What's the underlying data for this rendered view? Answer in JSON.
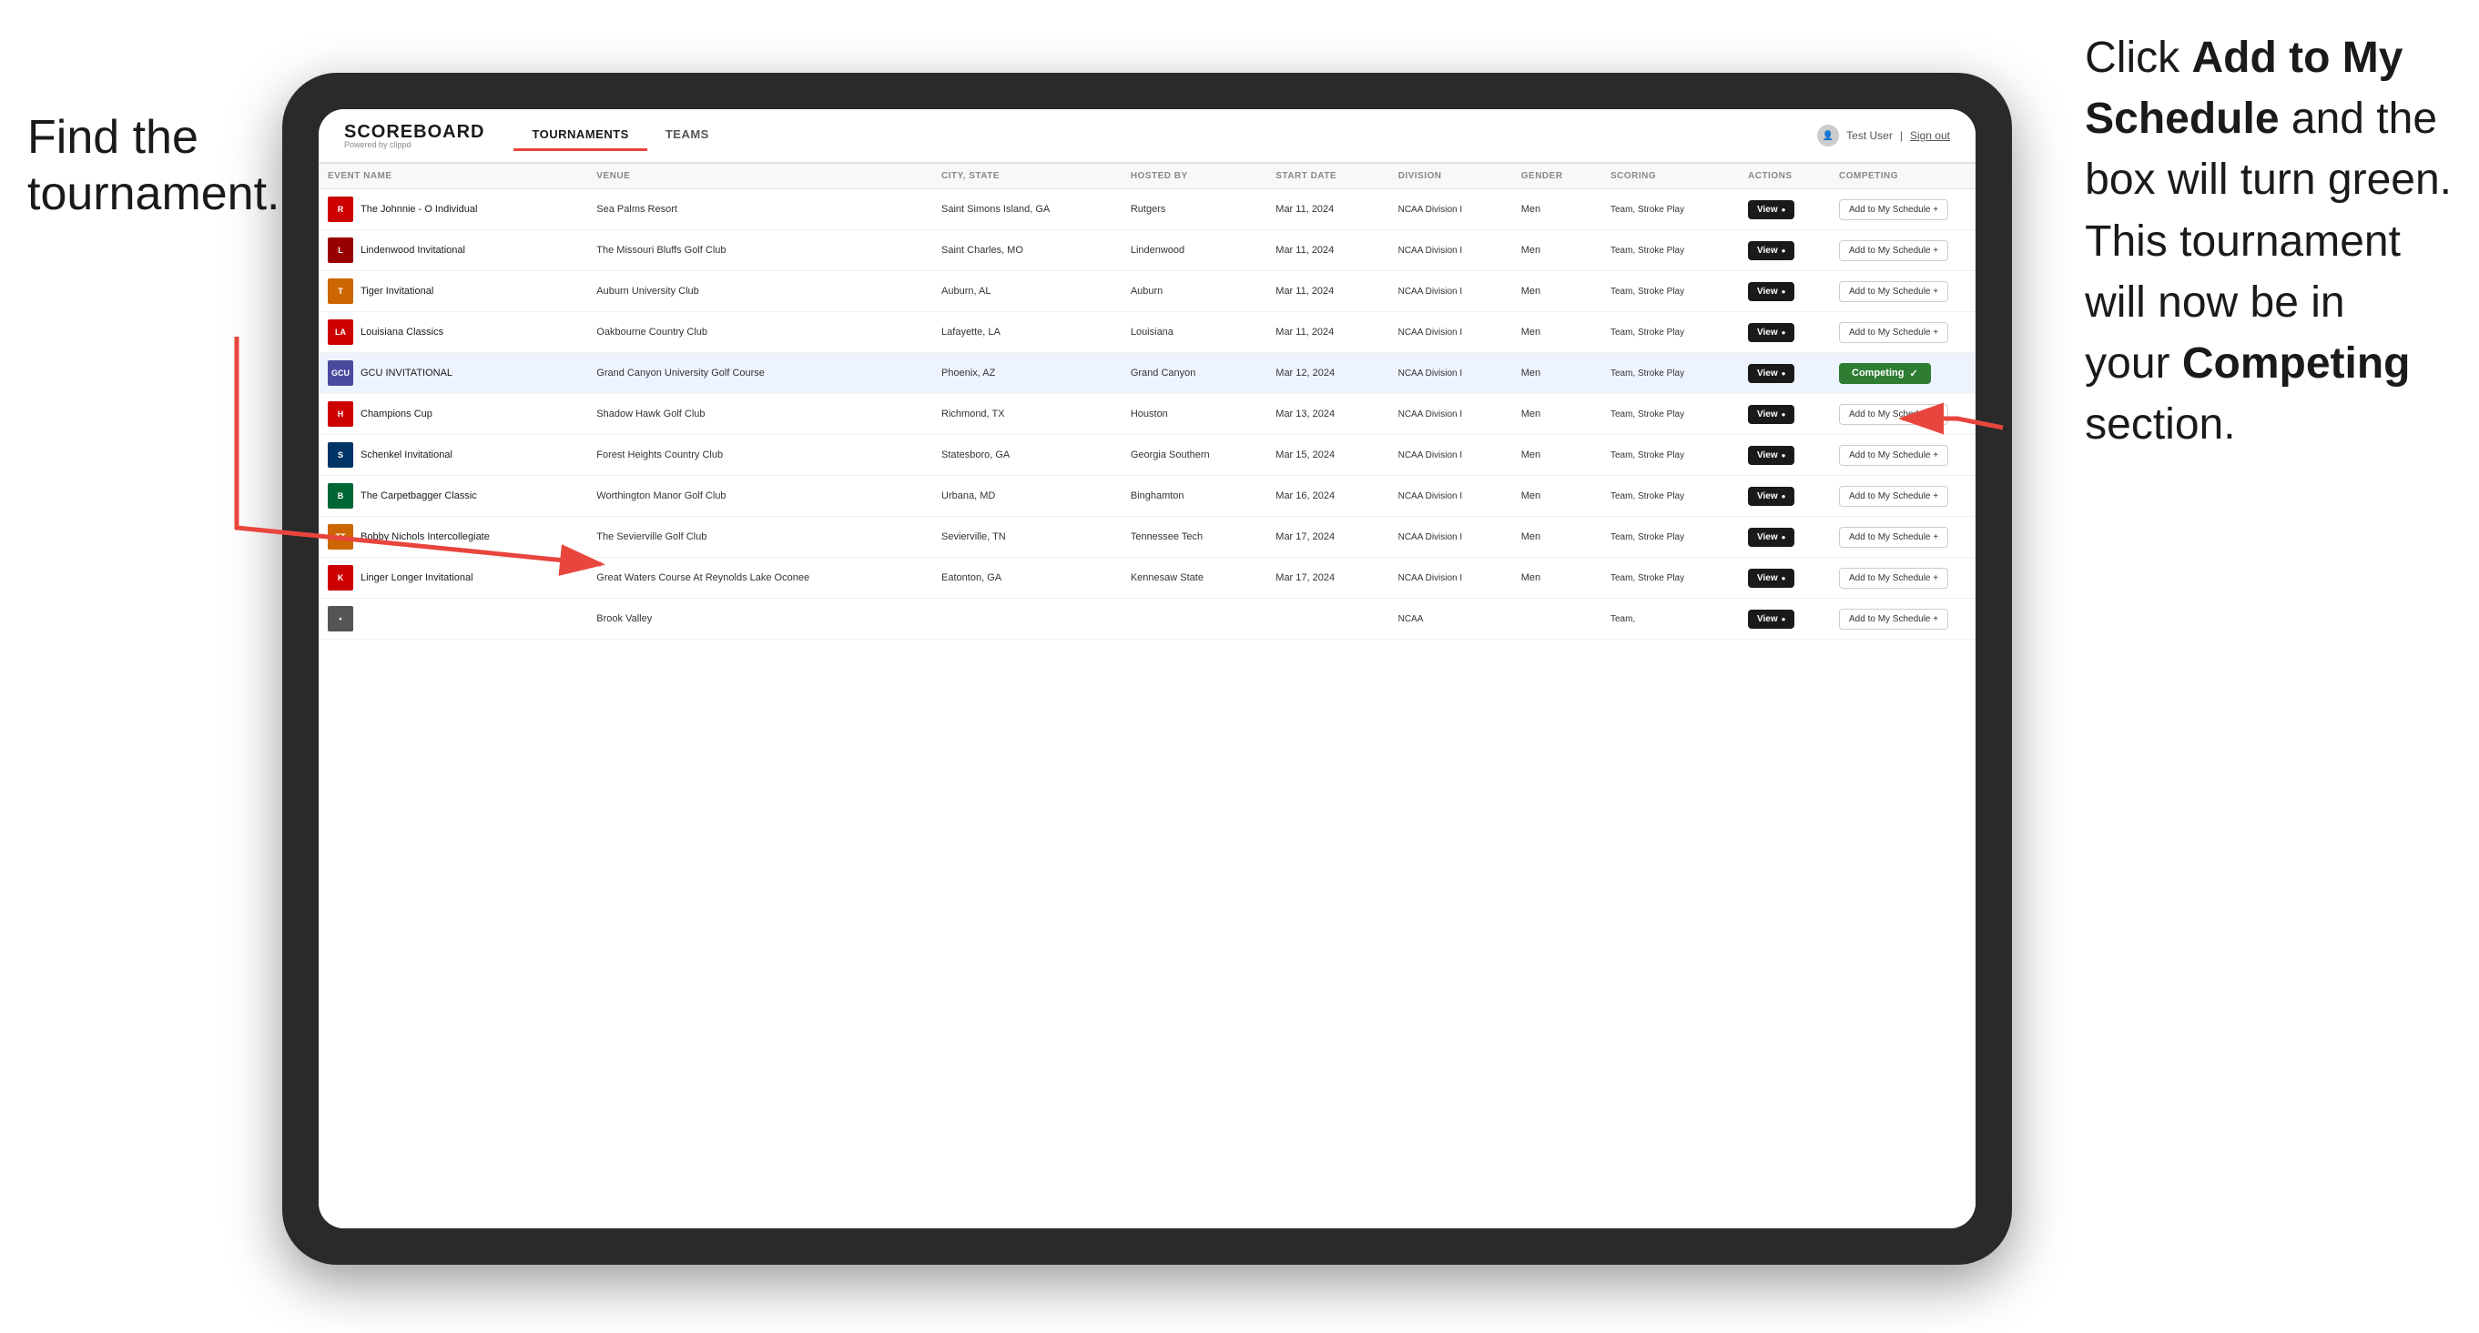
{
  "annotations": {
    "left": "Find the\ntournament.",
    "right_line1": "Click ",
    "right_bold1": "Add to My\nSchedule",
    "right_line2": " and the\nbox will turn green.\nThis tournament\nwill now be in\nyour ",
    "right_bold2": "Competing",
    "right_line3": "\nsection."
  },
  "app": {
    "logo_main": "SCOREBOARD",
    "logo_sub": "Powered by clippd",
    "nav_tabs": [
      "TOURNAMENTS",
      "TEAMS"
    ],
    "active_tab": "TOURNAMENTS",
    "user_label": "Test User",
    "signout_label": "Sign out"
  },
  "table": {
    "headers": [
      "EVENT NAME",
      "VENUE",
      "CITY, STATE",
      "HOSTED BY",
      "START DATE",
      "DIVISION",
      "GENDER",
      "SCORING",
      "ACTIONS",
      "COMPETING"
    ],
    "rows": [
      {
        "id": 1,
        "logo_color": "#cc0000",
        "logo_text": "R",
        "event_name": "The Johnnie - O Individual",
        "venue": "Sea Palms Resort",
        "city_state": "Saint Simons Island, GA",
        "hosted_by": "Rutgers",
        "start_date": "Mar 11, 2024",
        "division": "NCAA Division I",
        "gender": "Men",
        "scoring": "Team, Stroke Play",
        "action": "View",
        "competing_status": "add",
        "competing_label": "Add to My Schedule +",
        "highlighted": false
      },
      {
        "id": 2,
        "logo_color": "#990000",
        "logo_text": "L",
        "event_name": "Lindenwood Invitational",
        "venue": "The Missouri Bluffs Golf Club",
        "city_state": "Saint Charles, MO",
        "hosted_by": "Lindenwood",
        "start_date": "Mar 11, 2024",
        "division": "NCAA Division I",
        "gender": "Men",
        "scoring": "Team, Stroke Play",
        "action": "View",
        "competing_status": "add",
        "competing_label": "Add to My Schedule +",
        "highlighted": false
      },
      {
        "id": 3,
        "logo_color": "#cc6600",
        "logo_text": "T",
        "event_name": "Tiger Invitational",
        "venue": "Auburn University Club",
        "city_state": "Auburn, AL",
        "hosted_by": "Auburn",
        "start_date": "Mar 11, 2024",
        "division": "NCAA Division I",
        "gender": "Men",
        "scoring": "Team, Stroke Play",
        "action": "View",
        "competing_status": "add",
        "competing_label": "Add to My Schedule +",
        "highlighted": false
      },
      {
        "id": 4,
        "logo_color": "#cc0000",
        "logo_text": "LA",
        "event_name": "Louisiana Classics",
        "venue": "Oakbourne Country Club",
        "city_state": "Lafayette, LA",
        "hosted_by": "Louisiana",
        "start_date": "Mar 11, 2024",
        "division": "NCAA Division I",
        "gender": "Men",
        "scoring": "Team, Stroke Play",
        "action": "View",
        "competing_status": "add",
        "competing_label": "Add to My Schedule +",
        "highlighted": false
      },
      {
        "id": 5,
        "logo_color": "#4a4a9e",
        "logo_text": "GCU",
        "event_name": "GCU INVITATIONAL",
        "venue": "Grand Canyon University Golf Course",
        "city_state": "Phoenix, AZ",
        "hosted_by": "Grand Canyon",
        "start_date": "Mar 12, 2024",
        "division": "NCAA Division I",
        "gender": "Men",
        "scoring": "Team, Stroke Play",
        "action": "View",
        "competing_status": "competing",
        "competing_label": "Competing ✓",
        "highlighted": true
      },
      {
        "id": 6,
        "logo_color": "#cc0000",
        "logo_text": "H",
        "event_name": "Champions Cup",
        "venue": "Shadow Hawk Golf Club",
        "city_state": "Richmond, TX",
        "hosted_by": "Houston",
        "start_date": "Mar 13, 2024",
        "division": "NCAA Division I",
        "gender": "Men",
        "scoring": "Team, Stroke Play",
        "action": "View",
        "competing_status": "add",
        "competing_label": "Add to My Schedule +",
        "highlighted": false
      },
      {
        "id": 7,
        "logo_color": "#003366",
        "logo_text": "S",
        "event_name": "Schenkel Invitational",
        "venue": "Forest Heights Country Club",
        "city_state": "Statesboro, GA",
        "hosted_by": "Georgia Southern",
        "start_date": "Mar 15, 2024",
        "division": "NCAA Division I",
        "gender": "Men",
        "scoring": "Team, Stroke Play",
        "action": "View",
        "competing_status": "add",
        "competing_label": "Add to My Schedule +",
        "highlighted": false
      },
      {
        "id": 8,
        "logo_color": "#006633",
        "logo_text": "B",
        "event_name": "The Carpetbagger Classic",
        "venue": "Worthington Manor Golf Club",
        "city_state": "Urbana, MD",
        "hosted_by": "Binghamton",
        "start_date": "Mar 16, 2024",
        "division": "NCAA Division I",
        "gender": "Men",
        "scoring": "Team, Stroke Play",
        "action": "View",
        "competing_status": "add",
        "competing_label": "Add to My Schedule +",
        "highlighted": false
      },
      {
        "id": 9,
        "logo_color": "#cc6600",
        "logo_text": "TT",
        "event_name": "Bobby Nichols Intercollegiate",
        "venue": "The Sevierville Golf Club",
        "city_state": "Sevierville, TN",
        "hosted_by": "Tennessee Tech",
        "start_date": "Mar 17, 2024",
        "division": "NCAA Division I",
        "gender": "Men",
        "scoring": "Team, Stroke Play",
        "action": "View",
        "competing_status": "add",
        "competing_label": "Add to My Schedule +",
        "highlighted": false
      },
      {
        "id": 10,
        "logo_color": "#cc0000",
        "logo_text": "K",
        "event_name": "Linger Longer Invitational",
        "venue": "Great Waters Course At Reynolds Lake Oconee",
        "city_state": "Eatonton, GA",
        "hosted_by": "Kennesaw State",
        "start_date": "Mar 17, 2024",
        "division": "NCAA Division I",
        "gender": "Men",
        "scoring": "Team, Stroke Play",
        "action": "View",
        "competing_status": "add",
        "competing_label": "Add to My Schedule +",
        "highlighted": false
      },
      {
        "id": 11,
        "logo_color": "#555555",
        "logo_text": "•",
        "event_name": "",
        "venue": "Brook Valley",
        "city_state": "",
        "hosted_by": "",
        "start_date": "",
        "division": "NCAA",
        "gender": "",
        "scoring": "Team,",
        "action": "View",
        "competing_status": "add",
        "competing_label": "Add to My Schedule +",
        "highlighted": false
      }
    ]
  }
}
